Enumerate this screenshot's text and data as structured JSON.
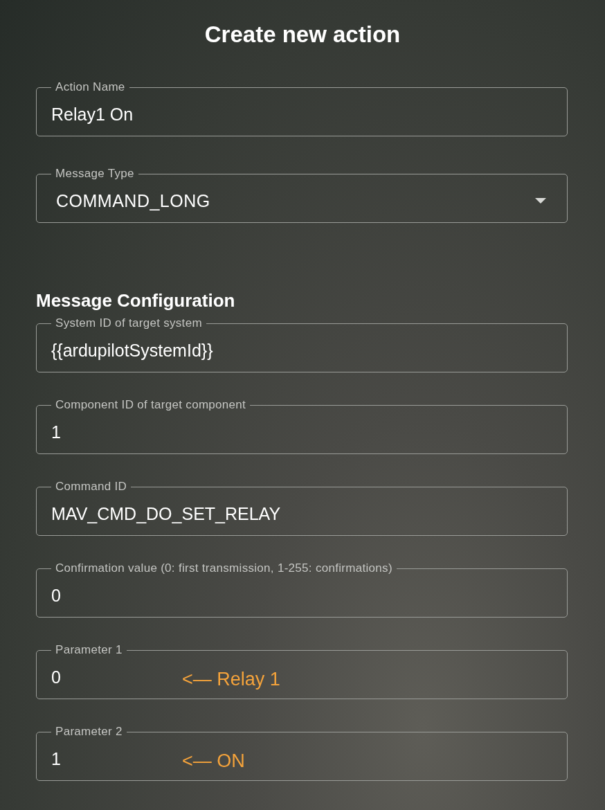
{
  "title": "Create new action",
  "fields": [
    {
      "kind": "text",
      "label": "Action Name",
      "value": "Relay1 On"
    },
    {
      "kind": "select",
      "label": "Message Type",
      "value": "COMMAND_LONG"
    }
  ],
  "section": {
    "title": "Message Configuration",
    "fields": [
      {
        "kind": "text",
        "label": "System ID of target system",
        "value": "{{ardupilotSystemId}}"
      },
      {
        "kind": "text",
        "label": "Component ID of target component",
        "value": "1"
      },
      {
        "kind": "text",
        "label": "Command ID",
        "value": "MAV_CMD_DO_SET_RELAY"
      },
      {
        "kind": "text",
        "label": "Confirmation value (0: first transmission, 1-255: confirmations)",
        "value": "0"
      },
      {
        "kind": "text",
        "label": "Parameter 1",
        "value": "0",
        "annotation": "<— Relay 1"
      },
      {
        "kind": "text",
        "label": "Parameter 2",
        "value": "1",
        "annotation": "<— ON"
      }
    ]
  }
}
